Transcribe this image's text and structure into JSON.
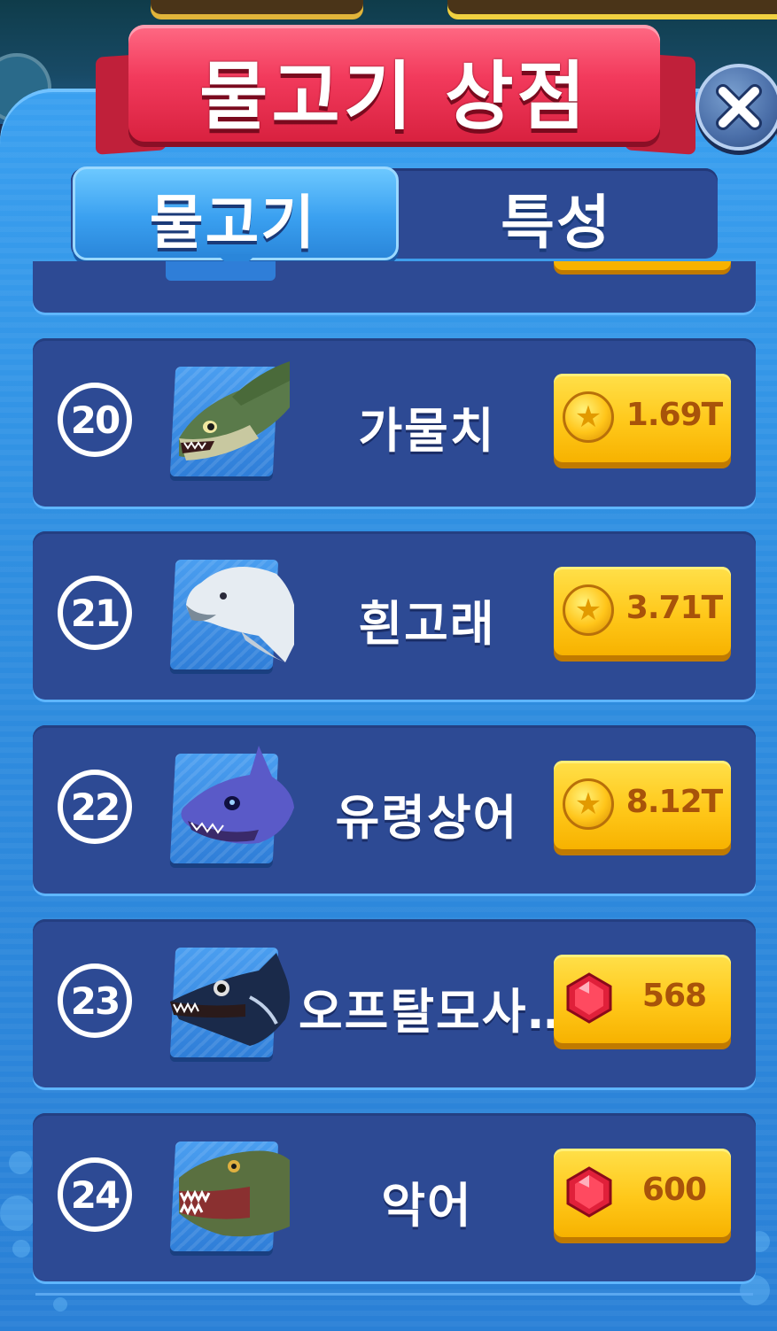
{
  "header": {
    "title": "물고기 상점",
    "close_icon": "close-icon"
  },
  "tabs": [
    {
      "label": "물고기",
      "active": true
    },
    {
      "label": "특성",
      "active": false
    }
  ],
  "items": [
    {
      "number": "20",
      "name": "가물치",
      "currency": "coin",
      "price": "1.69T",
      "fish_icon": "snakehead-fish-icon"
    },
    {
      "number": "21",
      "name": "흰고래",
      "currency": "coin",
      "price": "3.71T",
      "fish_icon": "beluga-whale-icon"
    },
    {
      "number": "22",
      "name": "유령상어",
      "currency": "coin",
      "price": "8.12T",
      "fish_icon": "ghost-shark-icon"
    },
    {
      "number": "23",
      "name": "오프탈모사…",
      "currency": "gem",
      "price": "568",
      "fish_icon": "ophthalmosaurus-icon"
    },
    {
      "number": "24",
      "name": "악어",
      "currency": "gem",
      "price": "600",
      "fish_icon": "crocodile-icon"
    }
  ],
  "colors": {
    "panel": "#2f8ee0",
    "row": "#2d4a94",
    "ribbon": "#f23a5c",
    "buy_button": "#ffc81a",
    "price_text": "#a8530a"
  }
}
